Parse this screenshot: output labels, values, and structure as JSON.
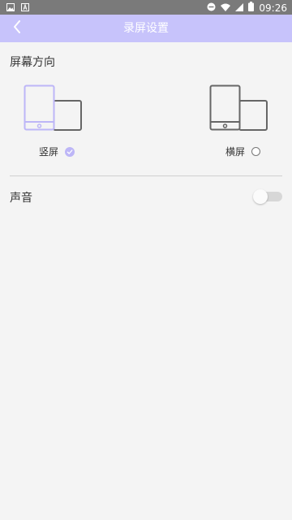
{
  "status_bar": {
    "left_icons": [
      "image-icon",
      "text-icon"
    ],
    "right_icons": [
      "do-not-disturb-icon",
      "wifi-icon",
      "signal-icon",
      "battery-icon"
    ],
    "time": "09:26"
  },
  "app_bar": {
    "title": "录屏设置",
    "back_icon": "chevron-left-icon",
    "color": "#c7c3fb"
  },
  "orientation": {
    "title": "屏幕方向",
    "options": [
      {
        "label": "竖屏",
        "selected": true
      },
      {
        "label": "横屏",
        "selected": false
      }
    ],
    "accent_color": "#bdb6f7"
  },
  "sound": {
    "label": "声音",
    "enabled": false
  }
}
